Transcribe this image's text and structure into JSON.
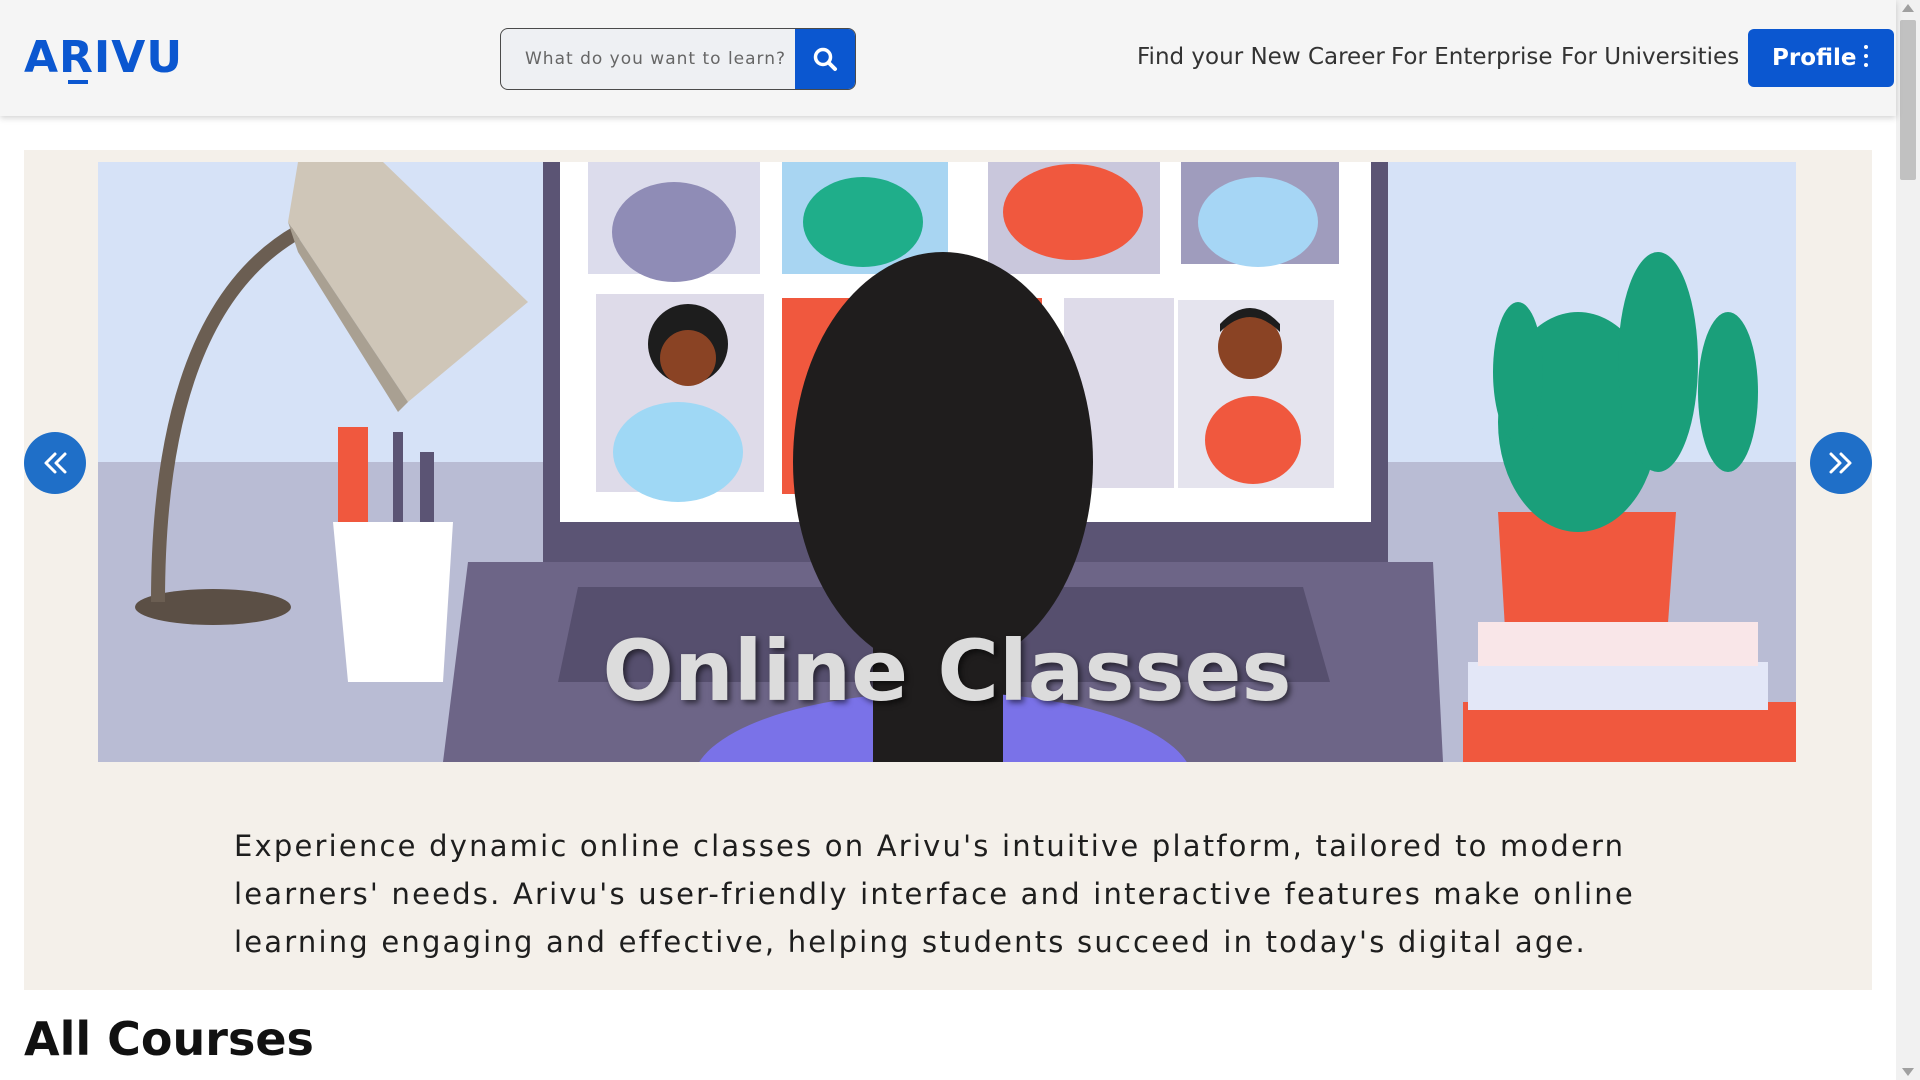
{
  "header": {
    "logo": "ARIVU",
    "search_placeholder": "What do you want to learn?",
    "nav": [
      "Find your New Career",
      "For Enterprise",
      "For Universities"
    ],
    "profile_label": "Profile"
  },
  "hero": {
    "slide_title": "Online Classes",
    "description": "Experience dynamic online classes on Arivu's intuitive platform, tailored to modern learners' needs. Arivu's user-friendly interface and interactive features make online learning engaging and effective, helping students succeed in today's digital age."
  },
  "sections": {
    "all_courses": "All Courses"
  },
  "colors": {
    "brand": "#0b57d0",
    "hero_bg": "#f4f0ea",
    "arrow": "#1f6fc8"
  }
}
